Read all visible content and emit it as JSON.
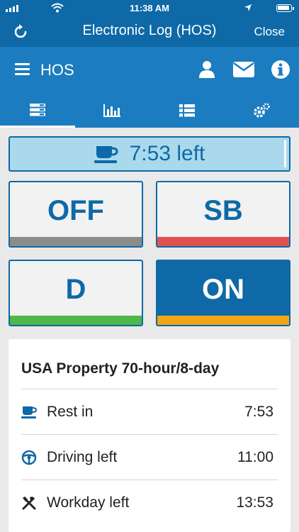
{
  "status_bar": {
    "time": "11:38 AM"
  },
  "title_bar": {
    "title": "Electronic Log (HOS)",
    "close_label": "Close"
  },
  "app_bar": {
    "title": "HOS"
  },
  "tabs": [
    {
      "icon": "log-icon",
      "active": true
    },
    {
      "icon": "bar-chart-icon",
      "active": false
    },
    {
      "icon": "list-icon",
      "active": false
    },
    {
      "icon": "settings-icon",
      "active": false
    }
  ],
  "time_left": {
    "icon": "coffee-cup-icon",
    "text": "7:53 left"
  },
  "duty_statuses": [
    {
      "label": "OFF",
      "color": "#8c8c8c",
      "selected": false
    },
    {
      "label": "SB",
      "color": "#e05252",
      "selected": false
    },
    {
      "label": "D",
      "color": "#4fb848",
      "selected": false
    },
    {
      "label": "ON",
      "color": "#f2a516",
      "selected": true
    }
  ],
  "summary": {
    "title": "USA Property 70-hour/8-day",
    "rows": [
      {
        "icon": "coffee-cup-icon",
        "label": "Rest in",
        "value": "7:53"
      },
      {
        "icon": "steering-wheel-icon",
        "label": "Driving left",
        "value": "11:00"
      },
      {
        "icon": "tools-icon",
        "label": "Workday left",
        "value": "13:53"
      }
    ]
  },
  "colors": {
    "primary": "#0e69a6",
    "header": "#1c7cc0",
    "banner": "#aad9ec"
  }
}
